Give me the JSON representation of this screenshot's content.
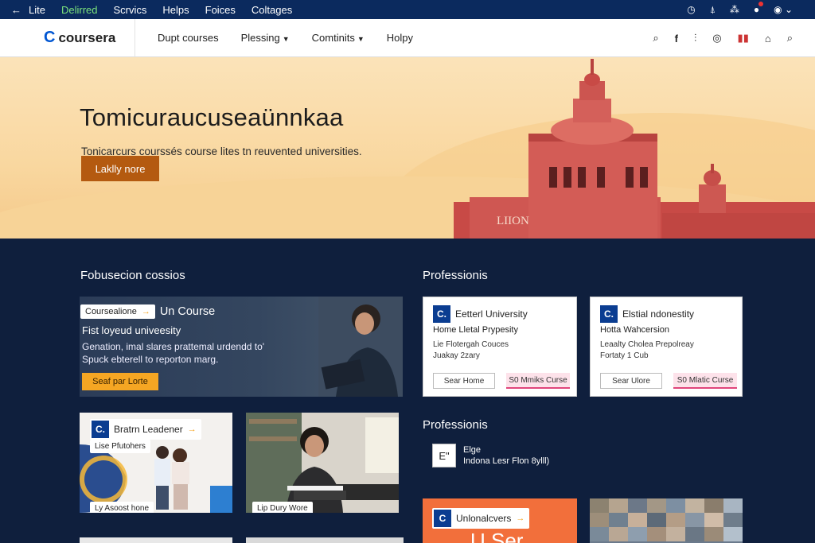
{
  "topbar": {
    "back_icon": "arrow-left-icon",
    "links": [
      "Lite",
      "Delirred",
      "Scrvics",
      "Helps",
      "Foices",
      "Coltages"
    ],
    "active_index": 1,
    "icons": [
      "clock-icon",
      "accessibility-icon",
      "grid-icon",
      "notification-icon",
      "profile-icon"
    ]
  },
  "header": {
    "logo_mark": "C",
    "logo_word": "coursera",
    "nav": [
      {
        "label": "Dupt courses",
        "dropdown": false
      },
      {
        "label": "Plessing",
        "dropdown": true
      },
      {
        "label": "Comtinits",
        "dropdown": true
      },
      {
        "label": "Holpy",
        "dropdown": false
      }
    ],
    "icons": [
      "search-icon",
      "facebook-icon",
      "chart-icon",
      "globe-icon",
      "stats-icon",
      "lock-icon",
      "search-icon"
    ]
  },
  "hero": {
    "title": "Tomicuraucuseaünnkaa",
    "subtitle": "Tonicarcurs courssés course lites tn reuvented universities.",
    "cta": "Laklly nore",
    "building_sign": "LIION"
  },
  "left": {
    "section_title": "Fobusecion cossios",
    "feature": {
      "pill": "Coursealione",
      "pill_arrow": "→",
      "pill_title": "Un Course",
      "title": "Fist loyeud univeesity",
      "desc": "Genation, imal slares prattemal urdendd to' Spuck ebterell to reporton marg.",
      "button": "Seaf par Lorte"
    },
    "card1": {
      "badge": "C.",
      "label": "Bratrn Leadener",
      "arrow": "→",
      "chip_top": "Lise Pfutohers",
      "chip_bottom": "Ly Asoost hone"
    },
    "card2": {
      "chip_bottom": "Lip Dury Wore"
    }
  },
  "right": {
    "section_title": "Professionis",
    "uni_cards": [
      {
        "badge": "C.",
        "name": "Eetterl University",
        "line1": "Home Lletal Prypesity",
        "line2a": "Lie Flotergah Couces",
        "line2b": "Juakay 2zary",
        "btn1": "Sear Home",
        "btn2": "S0 Mmiks Curse"
      },
      {
        "badge": "C.",
        "name": "Elstial ndonestity",
        "line1": "Hotta Wahcersion",
        "line2a": "Leaalty Cholea Prepolreay",
        "line2b": "Fortaty 1 Cub",
        "btn1": "Sear Ulore",
        "btn2": "S0 Mlatic Curse"
      }
    ],
    "section_title2": "Professionis",
    "prof_item": {
      "icon": "E\"",
      "line1": "Elge",
      "line2": "Indona Lesr Flon 8ylll)"
    },
    "orange_card": {
      "badge": "C",
      "label": "Unlonalcvers",
      "arrow": "→",
      "big": "U Ser"
    }
  }
}
